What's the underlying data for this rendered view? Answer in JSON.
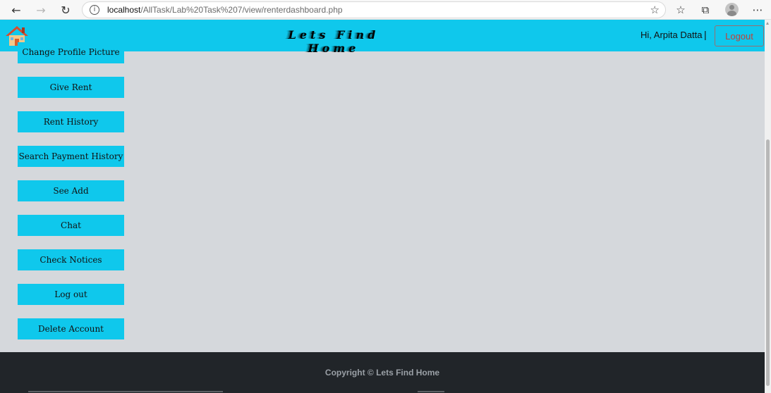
{
  "browser": {
    "url_host": "localhost",
    "url_path": "/AllTask/Lab%20Task%207/view/renterdashboard.php",
    "icons": [
      "back-arrow-icon",
      "forward-arrow-icon",
      "reload-icon",
      "info-icon",
      "favorite-star-icon",
      "favorites-icon",
      "collections-icon",
      "profile-avatar",
      "more-menu-icon"
    ]
  },
  "header": {
    "title": "Lets Find Home",
    "greeting": "Hi, Arpita Datta",
    "separator": "|",
    "logout_label": "Logout",
    "accent_color": "#0fc8ec"
  },
  "sidebar": {
    "items": [
      {
        "label": "Change Profile Picture"
      },
      {
        "label": "Give Rent"
      },
      {
        "label": "Rent History"
      },
      {
        "label": "Search Payment History"
      },
      {
        "label": "See Add"
      },
      {
        "label": "Chat"
      },
      {
        "label": "Check Notices"
      },
      {
        "label": "Log out"
      },
      {
        "label": "Delete Account"
      }
    ]
  },
  "footer": {
    "copyright": "Copyright © Lets Find Home",
    "background": "#212529"
  }
}
